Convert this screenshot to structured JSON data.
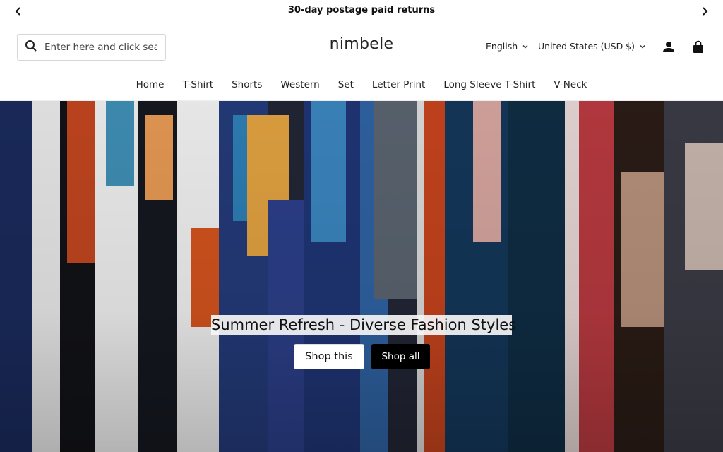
{
  "announcement": {
    "text": "30-day postage paid returns",
    "prev_icon": "chevron-left-icon",
    "next_icon": "chevron-right-icon"
  },
  "header": {
    "search": {
      "placeholder": "Enter here and click sear",
      "icon": "search-icon"
    },
    "logo": "nimbele",
    "language": "English",
    "currency": "United States (USD $)",
    "account_icon": "user-icon",
    "cart_icon": "shopping-bag-icon"
  },
  "nav": {
    "items": [
      "Home",
      "T-Shirt",
      "Shorts",
      "Western",
      "Set",
      "Letter Print",
      "Long Sleeve T-Shirt",
      "V-Neck"
    ]
  },
  "hero": {
    "title": "Summer Refresh - Diverse Fashion Styles",
    "primary_button": "Shop this",
    "secondary_button": "Shop all"
  },
  "colors": {
    "primary_button_bg": "#ffffff",
    "secondary_button_bg": "#000000",
    "text": "#222222"
  }
}
